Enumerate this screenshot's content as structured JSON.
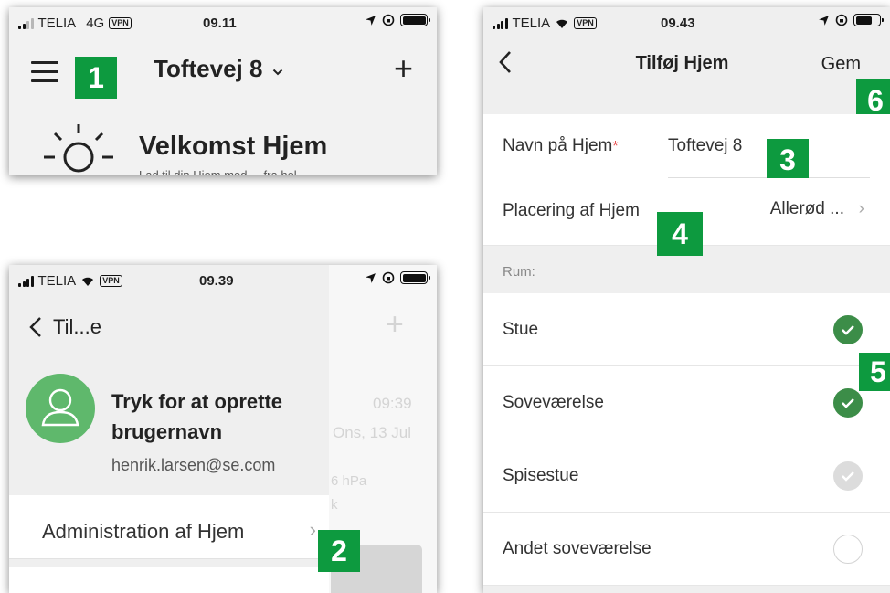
{
  "colors": {
    "badge": "#0d9a3f",
    "check_on": "#3c8d48",
    "check_disabled": "#dcdcdc",
    "avatar": "#5fb86c",
    "required": "#e94b4b"
  },
  "panel1": {
    "status": {
      "carrier": "TELIA",
      "network": "4G",
      "vpn": "VPN",
      "time": "09.11"
    },
    "home_title": "Toftevej 8",
    "plus": "+",
    "welcome": "Velkomst Hjem",
    "sub": "Lad til din Hjem med ... fra hel...",
    "badge": "1"
  },
  "panel2": {
    "status": {
      "carrier": "TELIA",
      "vpn": "VPN",
      "time": "09.39"
    },
    "back_label": "Til...e",
    "prompt": "Tryk for at oprette brugernavn",
    "email": "henrik.larsen@se.com",
    "menu_item": "Administration af Hjem",
    "badge": "2",
    "background": {
      "time": "09:39",
      "date": "Ons, 13 Jul",
      "pressure": "6 hPa",
      "extra": "k",
      "plus": "+"
    }
  },
  "panel3": {
    "status": {
      "carrier": "TELIA",
      "vpn": "VPN",
      "time": "09.43"
    },
    "nav": {
      "title": "Tilføj Hjem",
      "save": "Gem"
    },
    "name_label": "Navn på Hjem",
    "required_mark": "*",
    "name_value": "Toftevej 8",
    "location_label": "Placering af Hjem",
    "location_value": "Allerød ...",
    "rooms_label": "Rum:",
    "rooms": [
      {
        "name": "Stue",
        "state": "on"
      },
      {
        "name": "Soveværelse",
        "state": "on"
      },
      {
        "name": "Spisestue",
        "state": "disabled"
      },
      {
        "name": "Andet soveværelse",
        "state": "off"
      }
    ],
    "badges": {
      "name": "3",
      "location": "4",
      "rooms": "5",
      "save": "6"
    }
  }
}
